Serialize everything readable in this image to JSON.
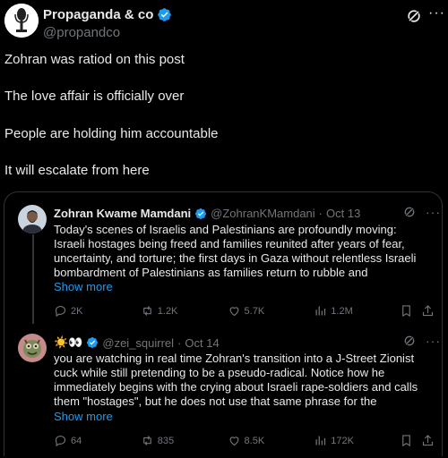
{
  "post": {
    "author_name": "Propaganda & co",
    "author_handle": "@propandco",
    "lines": [
      "Zohran was ratiod on this post",
      "The love affair is officially over",
      "People are holding him accountable",
      "It will escalate from here"
    ]
  },
  "quoted": {
    "author_name": "Zohran Kwame Mamdani",
    "author_handle": "@ZohranKMamdani",
    "date": "Oct 13",
    "body": "Today's scenes of Israelis and Palestinians are profoundly moving: Israeli hostages being freed and families reunited after years of fear, uncertainty, and torture; the first days in Gaza without relentless Israeli bombardment of Palestinians as families return to rubble and",
    "show_more": "Show more",
    "replies": "2K",
    "reposts": "1.2K",
    "likes": "5.7K",
    "views": "1.2M"
  },
  "reply": {
    "author_name": "☀️👀",
    "author_handle": "@zei_squirrel",
    "date": "Oct 14",
    "body": "you are watching in real time Zohran's transition into a J-Street Zionist cuck while still pretending to be a pseudo-radical. Notice how he immediately begins with the crying about Israeli rape-soldiers and calls them \"hostages\", but he does not use that same phrase for the",
    "show_more": "Show more",
    "replies": "64",
    "reposts": "835",
    "likes": "8.5K",
    "views": "172K"
  },
  "ui": {
    "more_glyph": "···",
    "dot": "·",
    "accent": "#1d9bf0",
    "verified_color": "#1d9bf0"
  }
}
